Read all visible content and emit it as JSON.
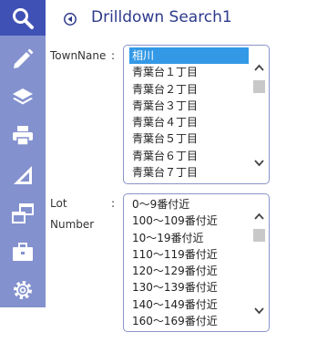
{
  "header": {
    "title": "Drilldown Search1"
  },
  "sidebar": {
    "icons": [
      "search-icon",
      "pencil-icon",
      "layers-icon",
      "printer-icon",
      "measure-icon",
      "windows-icon",
      "briefcase-icon",
      "gear-icon"
    ]
  },
  "town": {
    "label": "TownNane",
    "colon": ":",
    "items": [
      "相川",
      "青葉台１丁目",
      "青葉台２丁目",
      "青葉台３丁目",
      "青葉台４丁目",
      "青葉台５丁目",
      "青葉台６丁目",
      "青葉台７丁目"
    ],
    "selected_index": 0
  },
  "lot": {
    "label_line1": "Lot",
    "label_line2": "Number",
    "colon": ":",
    "items": [
      "0～9番付近",
      "100～109番付近",
      "10～19番付近",
      "110～119番付近",
      "120～129番付近",
      "130～139番付近",
      "140～149番付近",
      "160～169番付近"
    ]
  },
  "colors": {
    "sidebar": "#8391ce",
    "sidebar_active": "#3f51b5",
    "title": "#2d3a8c",
    "selection": "#3399e6",
    "border": "#8a94c8"
  }
}
